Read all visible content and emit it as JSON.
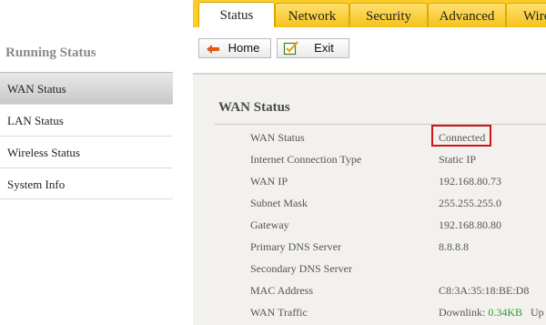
{
  "tabs": [
    "Status",
    "Network",
    "Security",
    "Advanced",
    "Wire"
  ],
  "toolbar": {
    "home_label": "Home",
    "exit_label": "Exit"
  },
  "sidebar": {
    "title": "Running Status",
    "items": [
      "WAN Status",
      "LAN Status",
      "Wireless Status",
      "System Info"
    ]
  },
  "section": {
    "title": "WAN Status"
  },
  "rows": [
    {
      "label": "WAN Status",
      "value": "Connected"
    },
    {
      "label": "Internet Connection Type",
      "value": "Static IP"
    },
    {
      "label": "WAN IP",
      "value": "192.168.80.73"
    },
    {
      "label": "Subnet Mask",
      "value": "255.255.255.0"
    },
    {
      "label": "Gateway",
      "value": "192.168.80.80"
    },
    {
      "label": "Primary DNS Server",
      "value": "8.8.8.8"
    },
    {
      "label": "Secondary DNS Server",
      "value": ""
    },
    {
      "label": "MAC Address",
      "value": "C8:3A:35:18:BE:D8"
    },
    {
      "label": "WAN Traffic",
      "value_prefix": "Downlink: ",
      "value_num": "0.34KB",
      "value_suffix": "   Up"
    }
  ],
  "colors": {
    "accent": "#fbcd2a",
    "highlight_border": "#d0151a",
    "traffic_value": "#2f9a2f"
  }
}
